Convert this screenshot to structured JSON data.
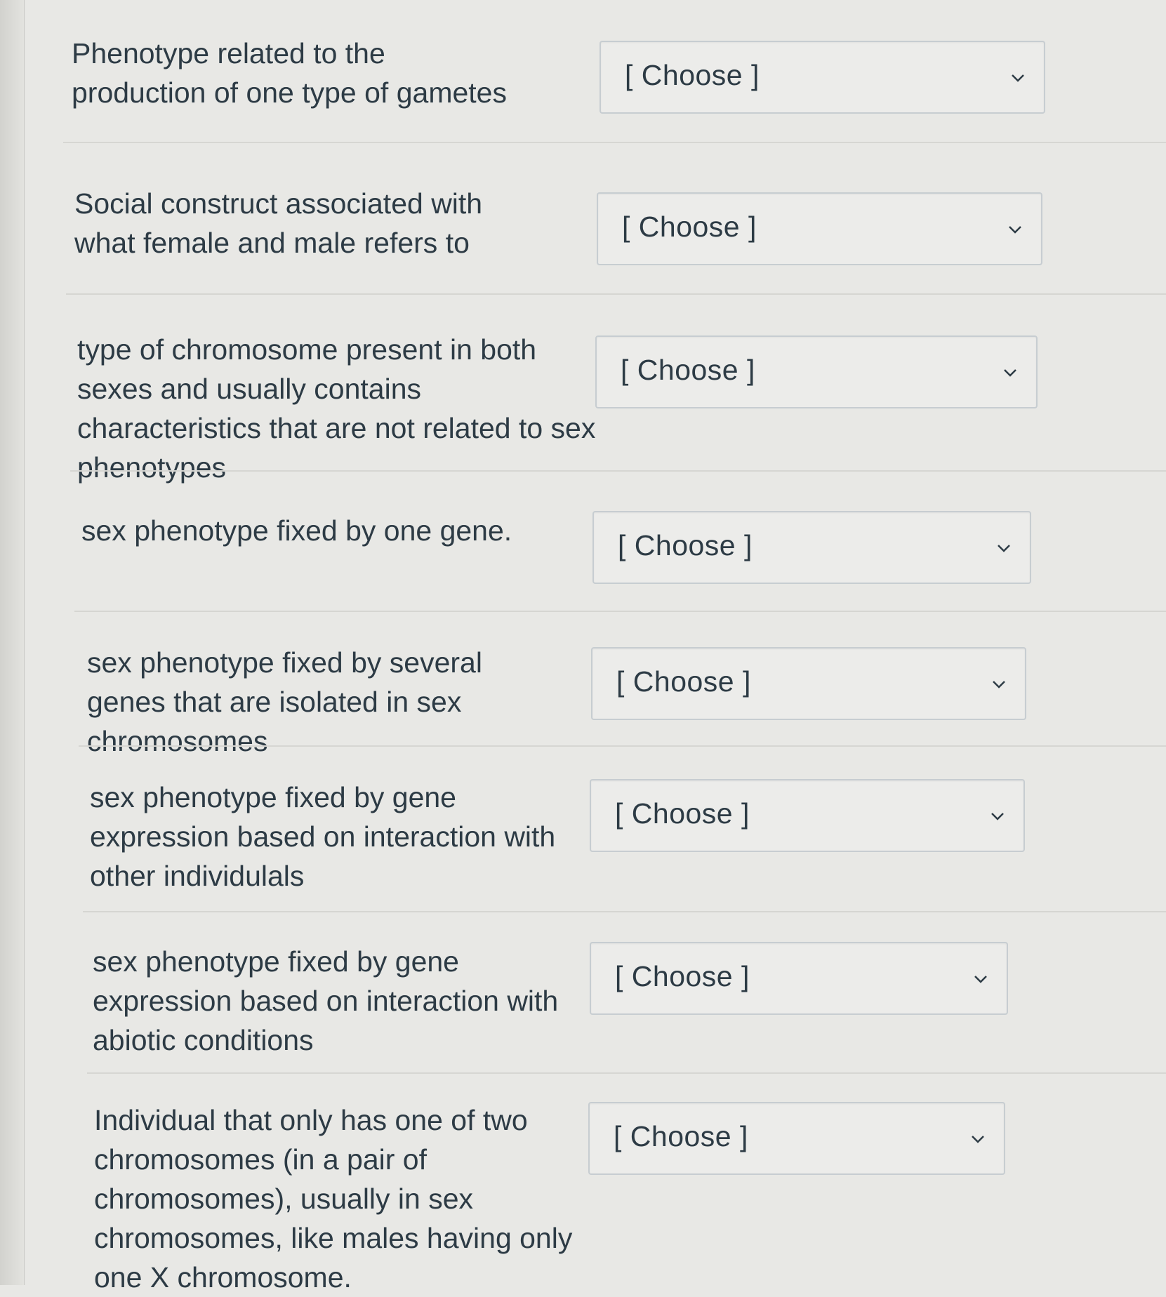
{
  "questions": [
    {
      "prompt": "Phenotype related to the production of one type of gametes",
      "selected": "[ Choose ]"
    },
    {
      "prompt": "Social construct associated with what female and male refers to",
      "selected": "[ Choose ]"
    },
    {
      "prompt": "type of chromosome present in both sexes and usually contains characteristics that are not related to sex phenotypes",
      "selected": "[ Choose ]"
    },
    {
      "prompt": "sex phenotype fixed by one gene.",
      "selected": "[ Choose ]"
    },
    {
      "prompt": "sex phenotype fixed by several genes that are isolated in sex chromosomes",
      "selected": "[ Choose ]"
    },
    {
      "prompt": "sex phenotype fixed by gene expression based on interaction with other individulals",
      "selected": "[ Choose ]"
    },
    {
      "prompt": "sex phenotype fixed by gene expression based on interaction with abiotic conditions",
      "selected": "[ Choose ]"
    },
    {
      "prompt": "Individual that only has one of two chromosomes (in a pair of chromosomes), usually in sex chromosomes, like males having only one X chromosome.",
      "selected": "[ Choose ]"
    }
  ],
  "icons": {
    "dropdown": "chevron-down-icon"
  }
}
